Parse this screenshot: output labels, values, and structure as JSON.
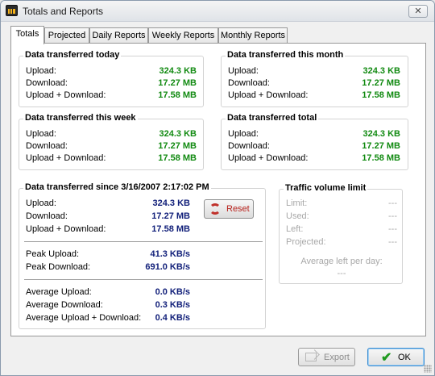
{
  "window": {
    "title": "Totals and Reports",
    "close_label": "✕"
  },
  "tabs": [
    "Totals",
    "Projected",
    "Daily Reports",
    "Weekly Reports",
    "Monthly Reports"
  ],
  "active_tab": "Totals",
  "today": {
    "title": "Data transferred today",
    "upload_label": "Upload:",
    "upload": "324.3 KB",
    "download_label": "Download:",
    "download": "17.27 MB",
    "both_label": "Upload + Download:",
    "both": "17.58 MB"
  },
  "month": {
    "title": "Data transferred this month",
    "upload_label": "Upload:",
    "upload": "324.3 KB",
    "download_label": "Download:",
    "download": "17.27 MB",
    "both_label": "Upload + Download:",
    "both": "17.58 MB"
  },
  "week": {
    "title": "Data transferred this week",
    "upload_label": "Upload:",
    "upload": "324.3 KB",
    "download_label": "Download:",
    "download": "17.27 MB",
    "both_label": "Upload + Download:",
    "both": "17.58 MB"
  },
  "total": {
    "title": "Data transferred total",
    "upload_label": "Upload:",
    "upload": "324.3 KB",
    "download_label": "Download:",
    "download": "17.27 MB",
    "both_label": "Upload + Download:",
    "both": "17.58 MB"
  },
  "since": {
    "title": "Data transferred since 3/16/2007 2:17:02 PM",
    "upload_label": "Upload:",
    "upload": "324.3 KB",
    "download_label": "Download:",
    "download": "17.27 MB",
    "both_label": "Upload + Download:",
    "both": "17.58 MB",
    "peak_upload_label": "Peak Upload:",
    "peak_upload": "41.3 KB/s",
    "peak_download_label": "Peak Download:",
    "peak_download": "691.0 KB/s",
    "avg_upload_label": "Average Upload:",
    "avg_upload": "0.0 KB/s",
    "avg_download_label": "Average Download:",
    "avg_download": "0.3 KB/s",
    "avg_both_label": "Average Upload + Download:",
    "avg_both": "0.4 KB/s",
    "reset_label": "Reset"
  },
  "limit": {
    "title": "Traffic volume limit",
    "limit_label": "Limit:",
    "limit": "---",
    "used_label": "Used:",
    "used": "---",
    "left_label": "Left:",
    "left": "---",
    "projected_label": "Projected:",
    "projected": "---",
    "avg_left_label": "Average left per day:",
    "avg_left": "---"
  },
  "buttons": {
    "export": "Export",
    "ok": "OK"
  },
  "colors": {
    "value_green": "#118a11",
    "value_navy": "#12207a",
    "disabled_gray": "#a8a8a8"
  }
}
